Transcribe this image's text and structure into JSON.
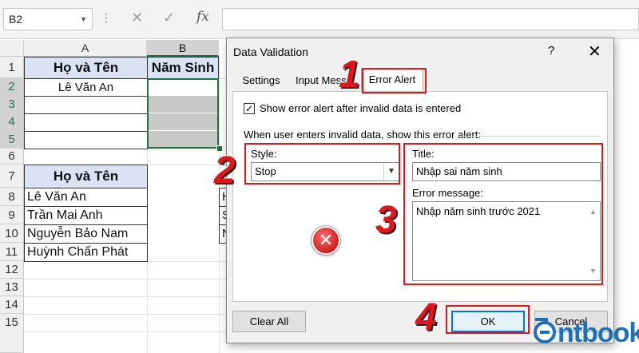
{
  "formula_bar": {
    "name_box": "B2",
    "cancel_icon": "✕",
    "enter_icon": "✓",
    "fx_label": "fx",
    "formula": ""
  },
  "sheet": {
    "columns": [
      "A",
      "B"
    ],
    "rows": [
      "1",
      "2",
      "3",
      "4",
      "5",
      "6",
      "7",
      "8",
      "9",
      "10",
      "11",
      "12",
      "13",
      "14",
      "15"
    ],
    "table1": {
      "header_a": "Họ và Tên",
      "header_b": "Năm Sinh",
      "row2_a": "Lê Văn An"
    },
    "table2": {
      "header": "Họ và Tên",
      "names": [
        "Lê Văn An",
        "Trần Mai Anh",
        "Nguyễn Bảo Nam",
        "Huỳnh Chấn Phát"
      ]
    },
    "peek_chars": [
      "H",
      "S",
      "N"
    ]
  },
  "dialog": {
    "title": "Data Validation",
    "help": "?",
    "close": "✕",
    "tabs": [
      "Settings",
      "Input Messag",
      "Error Alert"
    ],
    "show_alert_label": "Show error alert after invalid data is entered",
    "show_alert_checked": true,
    "group_label": "When user enters invalid data, show this error alert:",
    "style_label": "Style:",
    "style_value": "Stop",
    "title_label": "Title:",
    "title_value": "Nhập sai năm sinh",
    "message_label": "Error message:",
    "message_value": "Nhập năm sinh trước 2021",
    "clear_all": "Clear All",
    "ok": "OK",
    "cancel": "Cancel"
  },
  "annotations": {
    "step1": "1",
    "step2": "2",
    "step3": "3",
    "step4": "4"
  },
  "watermark": "ntbook",
  "colors": {
    "excel_green": "#217346",
    "header_blue": "#dae3f3",
    "highlight_red": "#e0161c",
    "focus_blue": "#0078d7",
    "logo_blue": "#1f6fb5"
  }
}
